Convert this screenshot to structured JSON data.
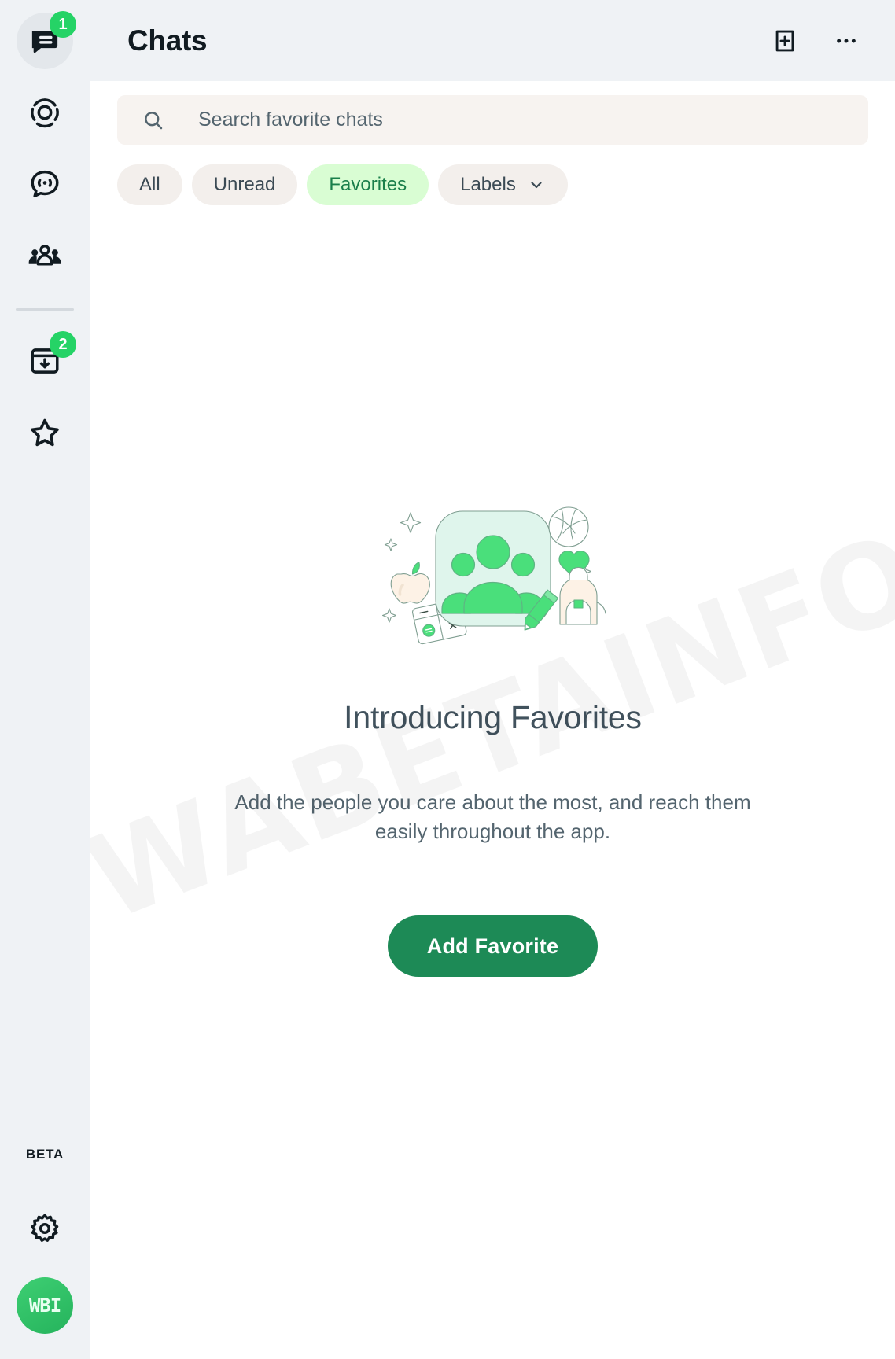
{
  "colors": {
    "rail_bg": "#eff2f5",
    "badge_green": "#25d366",
    "chip_active_bg": "#d9fdd3",
    "chip_active_text": "#1a7f4b",
    "chip_bg": "#f3efec",
    "search_bg": "#f7f3f0",
    "primary_button": "#1d8a56",
    "avatar_green": "#25b35c",
    "illustration_green": "#4adf7b",
    "illustration_card": "#dff5ec",
    "illustration_cream": "#fdf2e6",
    "text_primary": "#111b21",
    "text_secondary": "#54656f",
    "title_color": "#41525d"
  },
  "nav_rail": {
    "items": [
      {
        "id": "chats",
        "icon": "chats-icon",
        "label": "Chats",
        "badge": "1",
        "active": true
      },
      {
        "id": "status",
        "icon": "status-icon",
        "label": "Status",
        "badge": null,
        "active": false
      },
      {
        "id": "channels",
        "icon": "channels-icon",
        "label": "Channels",
        "badge": null,
        "active": false
      },
      {
        "id": "communities",
        "icon": "communities-icon",
        "label": "Communities",
        "badge": null,
        "active": false
      }
    ],
    "lower_items": [
      {
        "id": "archived",
        "icon": "archived-icon",
        "label": "Archived",
        "badge": "2",
        "active": false
      },
      {
        "id": "starred",
        "icon": "star-icon",
        "label": "Starred messages",
        "badge": null,
        "active": false
      }
    ],
    "beta_label": "BETA",
    "settings": {
      "id": "settings",
      "icon": "gear-icon",
      "label": "Settings"
    },
    "avatar": {
      "id": "profile",
      "initials": "WBI",
      "label": "Profile"
    }
  },
  "header": {
    "title": "Chats",
    "new_chat": {
      "icon": "new-chat-icon",
      "label": "New chat"
    },
    "menu": {
      "icon": "overflow-menu-icon",
      "label": "Menu"
    }
  },
  "search": {
    "icon": "search-icon",
    "placeholder": "Search favorite chats",
    "value": ""
  },
  "filters": {
    "chips": [
      {
        "id": "all",
        "label": "All",
        "active": false,
        "has_chevron": false
      },
      {
        "id": "unread",
        "label": "Unread",
        "active": false,
        "has_chevron": false
      },
      {
        "id": "favorites",
        "label": "Favorites",
        "active": true,
        "has_chevron": false
      },
      {
        "id": "labels",
        "label": "Labels",
        "active": false,
        "has_chevron": true
      }
    ]
  },
  "empty_state": {
    "illustration_name": "favorites-illustration",
    "title": "Introducing Favorites",
    "description": "Add the people you care about the most, and reach them easily throughout the app.",
    "cta_label": "Add Favorite"
  },
  "watermark": {
    "text": "WABETAINFO"
  }
}
